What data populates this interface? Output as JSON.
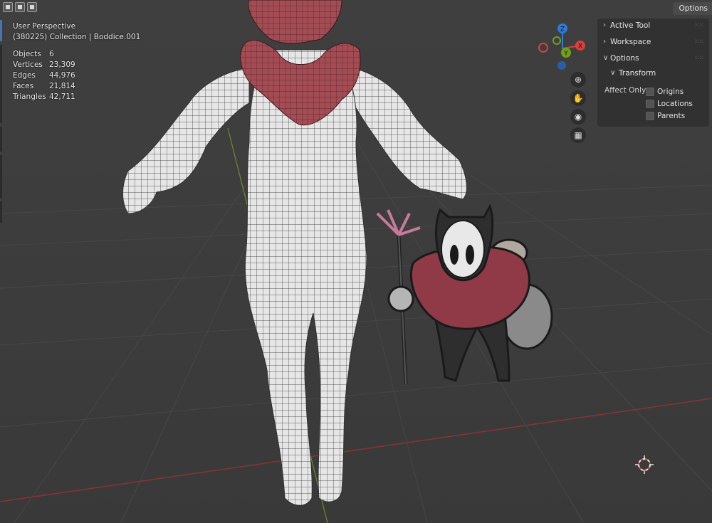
{
  "header": {
    "options_label": "Options"
  },
  "overlay": {
    "perspective": "User Perspective",
    "collection": "(380225) Collection | Boddice.001",
    "stats": [
      {
        "key": "Objects",
        "value": "6"
      },
      {
        "key": "Vertices",
        "value": "23,309"
      },
      {
        "key": "Edges",
        "value": "44,976"
      },
      {
        "key": "Faces",
        "value": "21,814"
      },
      {
        "key": "Triangles",
        "value": "42,711"
      }
    ]
  },
  "gizmo": {
    "x_label": "X",
    "y_label": "Y",
    "z_label": "Z",
    "x_color": "#d9403b",
    "y_color": "#6da11d",
    "z_color": "#2f7bd9"
  },
  "nav_icons": [
    "zoom-icon",
    "hand-pan-icon",
    "camera-icon",
    "grid-view-icon"
  ],
  "side_panel": {
    "active_tool": "Active Tool",
    "workspace": "Workspace",
    "options": "Options",
    "transform": "Transform",
    "affect_only": "Affect Only",
    "checkboxes": [
      {
        "label": "Origins",
        "checked": false
      },
      {
        "label": "Locations",
        "checked": false
      },
      {
        "label": "Parents",
        "checked": false
      }
    ]
  },
  "colors": {
    "viewport_bg": "#3d3d3d",
    "grid_line": "#474747",
    "x_axis": "#8b3236",
    "y_axis": "#6a8f2a",
    "mesh_body": "#e8e8e8",
    "mesh_collar": "#a44c54",
    "character_scarf": "#8f3a46"
  }
}
